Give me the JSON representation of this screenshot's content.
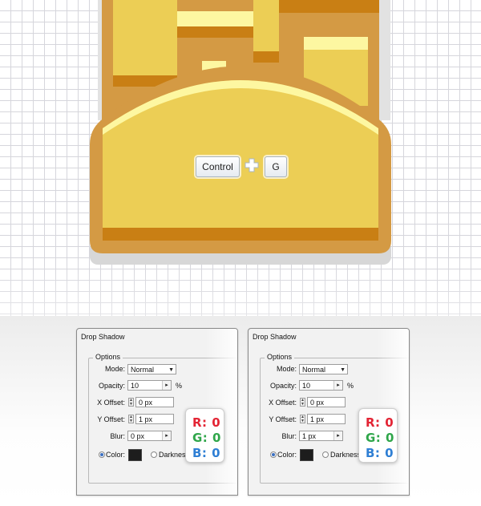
{
  "shortcut": {
    "key1": "Control",
    "key2": "G"
  },
  "dialogs": [
    {
      "title": "Drop Shadow",
      "options_label": "Options",
      "mode_label": "Mode:",
      "mode_value": "Normal",
      "opacity_label": "Opacity:",
      "opacity_value": "10",
      "opacity_unit": "%",
      "xoffset_label": "X Offset:",
      "xoffset_value": "0 px",
      "yoffset_label": "Y Offset:",
      "yoffset_value": "1 px",
      "blur_label": "Blur:",
      "blur_value": "0 px",
      "color_label": "Color:",
      "darkness_label": "Darkness",
      "rgb": {
        "r": "R: 0",
        "g": "G: 0",
        "b": "B: 0"
      }
    },
    {
      "title": "Drop Shadow",
      "options_label": "Options",
      "mode_label": "Mode:",
      "mode_value": "Normal",
      "opacity_label": "Opacity:",
      "opacity_value": "10",
      "opacity_unit": "%",
      "xoffset_label": "X Offset:",
      "xoffset_value": "0 px",
      "yoffset_label": "Y Offset:",
      "yoffset_value": "1 px",
      "blur_label": "Blur:",
      "blur_value": "1 px",
      "color_label": "Color:",
      "darkness_label": "Darkness",
      "rgb": {
        "r": "R: 0",
        "g": "G: 0",
        "b": "B: 0"
      }
    }
  ],
  "colors": {
    "folder_orange": "#d49a44",
    "folder_gold": "#ecce55",
    "folder_stripe": "#c97f14",
    "highlight": "#fdf7a1",
    "shadow_color": "#1d1d1d",
    "rgb_red": "#e32434",
    "rgb_green": "#2fa64a",
    "rgb_blue": "#2f7fd4"
  },
  "icons": [
    "plus-icon",
    "dropdown-arrow-icon",
    "stepper-arrow-icon",
    "spinner-icon",
    "radio-icon"
  ]
}
